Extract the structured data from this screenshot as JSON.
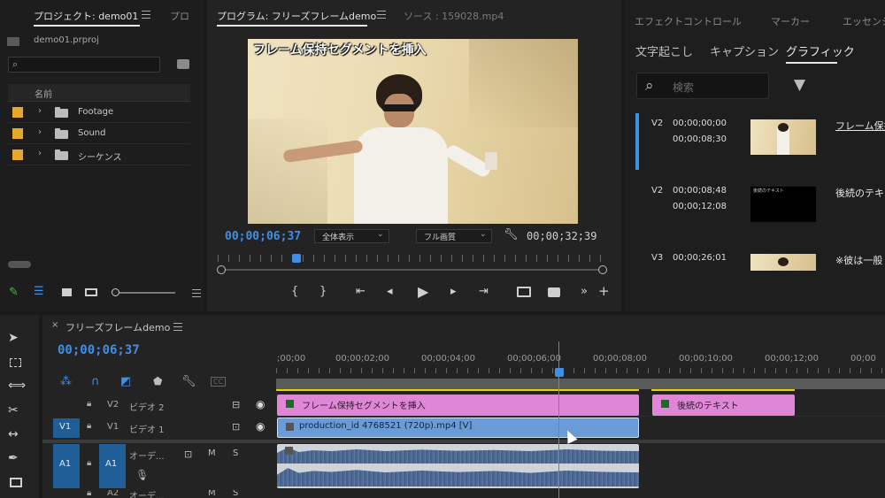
{
  "project": {
    "tab_title": "プロジェクト: demo01",
    "tab_next": "プロ",
    "file_name": "demo01.prproj",
    "column_name": "名前",
    "items": [
      {
        "label": "Footage"
      },
      {
        "label": "Sound"
      },
      {
        "label": "シーケンス"
      }
    ]
  },
  "program": {
    "tab_title": "プログラム: フリーズフレームdemo",
    "source_tab": "ソース : 159028.mp4",
    "overlay_title": "フレーム保持セグメントを挿入",
    "timecode_current": "00;00;06;37",
    "timecode_duration": "00;00;32;39",
    "zoom_select": "全体表示",
    "quality_select": "フル画質"
  },
  "right_panel": {
    "tabs_top": [
      "エフェクトコントロール",
      "マーカー",
      "エッセンシ"
    ],
    "tabs_second": [
      "文字起こし",
      "キャプション",
      "グラフィック"
    ],
    "search_placeholder": "検索",
    "graphics": [
      {
        "track": "V2",
        "start": "00;00;00;00",
        "end": "00;00;08;30",
        "title": "フレーム保持"
      },
      {
        "track": "V2",
        "start": "00;00;08;48",
        "end": "00;00;12;08",
        "title": "後続のテキス"
      },
      {
        "track": "V3",
        "start": "00;00;26;01",
        "end": "",
        "title": "※彼は一般"
      }
    ],
    "thumb2_caption": "後続のテキスト"
  },
  "timeline": {
    "sequence_name": "フリーズフレームdemo",
    "timecode": "00;00;06;37",
    "ruler_labels": [
      ";00;00",
      "00;00;02;00",
      "00;00;04;00",
      "00;00;06;00",
      "00;00;08;00",
      "00;00;10;00",
      "00;00;12;00",
      "00;00"
    ],
    "tracks": {
      "v2": {
        "label": "V2",
        "name": "ビデオ 2"
      },
      "v1": {
        "label": "V1",
        "name": "ビデオ 1",
        "source": "V1"
      },
      "a1": {
        "label": "A1",
        "name": "オーデ...",
        "source": "A1",
        "m": "M",
        "s": "S"
      },
      "a2": {
        "label": "A2",
        "name": "オーデ...",
        "m": "M",
        "s": "S"
      }
    },
    "clips": {
      "clip1": "フレーム保持セグメントを挿入",
      "clip2": "後続のテキスト",
      "video": "production_id 4768521 (720p).mp4 [V]"
    }
  },
  "colors": {
    "accent_blue": "#3f8fe6",
    "graphic_clip": "#df86d6",
    "video_clip": "#6b9bd6",
    "audio_clip": "#4f6a93",
    "swatch_orange": "#e8a823",
    "work_area_yellow": "#e6d400"
  }
}
